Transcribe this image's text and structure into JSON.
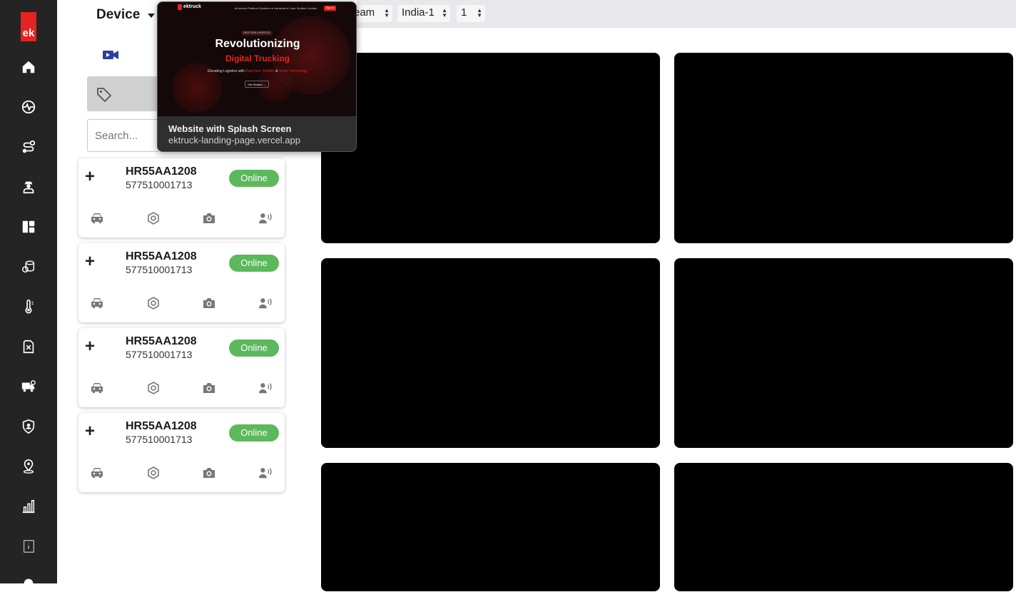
{
  "sidebar": {
    "logo_text": "ek",
    "brand_color": "#e52420",
    "items": [
      {
        "icon": "home-icon"
      },
      {
        "icon": "heartbeat-icon"
      },
      {
        "icon": "route-icon"
      },
      {
        "icon": "driver-icon"
      },
      {
        "icon": "dashboard-icon"
      },
      {
        "icon": "database-icon"
      },
      {
        "icon": "thermometer-icon"
      },
      {
        "icon": "fuel-icon"
      },
      {
        "icon": "truck-settings-icon"
      },
      {
        "icon": "shield-icon"
      },
      {
        "icon": "location-pin-icon"
      },
      {
        "icon": "bar-chart-icon"
      },
      {
        "icon": "info-book-icon"
      },
      {
        "icon": "settings-icon"
      }
    ]
  },
  "header": {
    "title": "Device",
    "selects": [
      {
        "value": "eam"
      },
      {
        "value": "India-1"
      },
      {
        "value": "1"
      }
    ]
  },
  "search": {
    "placeholder": "Search..."
  },
  "devices": [
    {
      "plate": "HR55AA1208",
      "imei": "577510001713",
      "status": "Online"
    },
    {
      "plate": "HR55AA1208",
      "imei": "577510001713",
      "status": "Online"
    },
    {
      "plate": "HR55AA1208",
      "imei": "577510001713",
      "status": "Online"
    },
    {
      "plate": "HR55AA1208",
      "imei": "577510001713",
      "status": "Online"
    }
  ],
  "status_color": "#5cb85c",
  "tooltip": {
    "title": "Website with Splash Screen",
    "url": "ektruck-landing-page.vercel.app",
    "preview": {
      "logo": "ektruck",
      "nav_links": "eKonnect Platform   Solutions ▾   Industries ▾   Case Studies   Contact",
      "sign_in": "Sign in",
      "badge": "NEXT-GEN LOGISTICS",
      "headline": "Revolutionizing",
      "headline_red": "Digital Trucking",
      "subtitle_pre": "Elevating Logistics with ",
      "subtitle_hl1": "Real-time Visibility",
      "subtitle_mid": " & ",
      "subtitle_hl2": "Smart Technology",
      "cta": "Get Started →"
    }
  }
}
